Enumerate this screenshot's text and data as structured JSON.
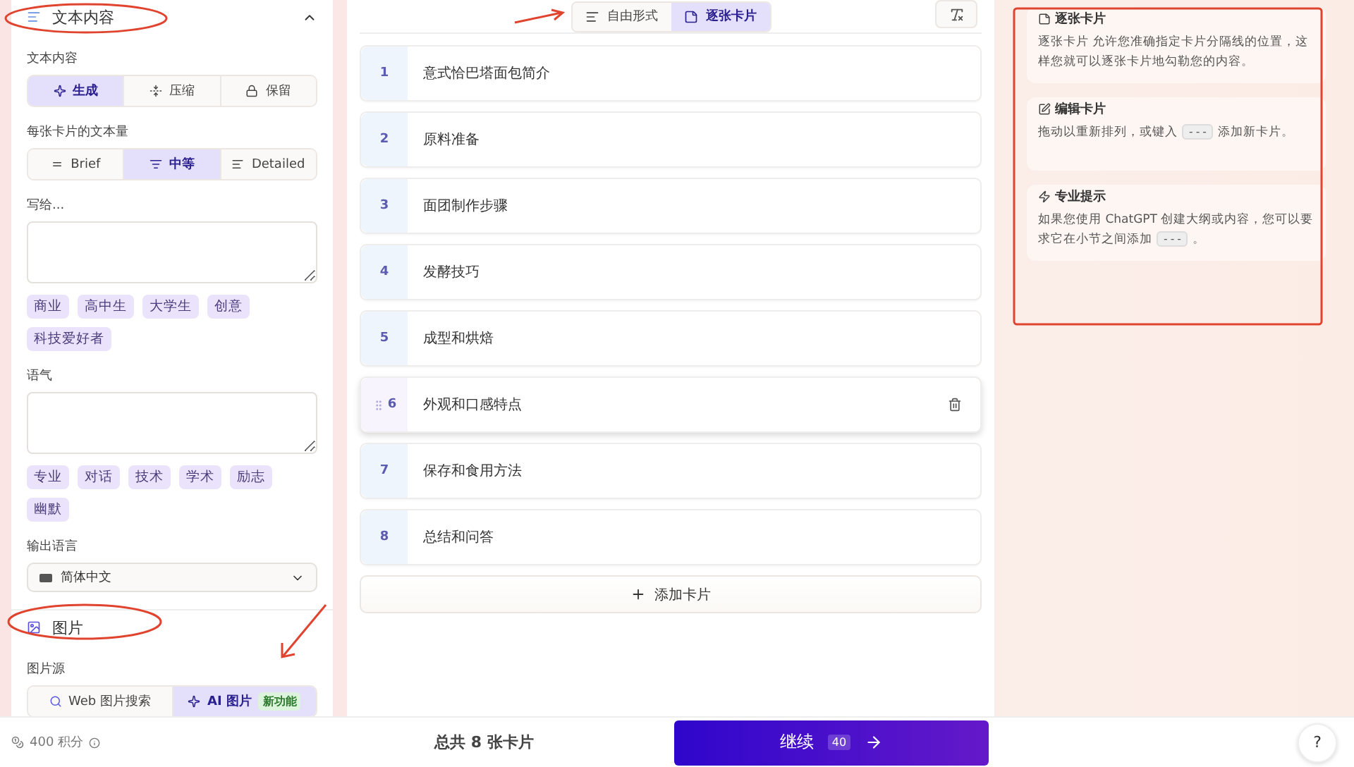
{
  "sidebar": {
    "text_section": {
      "title": "文本内容",
      "expanded": true,
      "content_label": "文本内容",
      "content_options": [
        {
          "kind": "generate",
          "label": "生成",
          "selected": true
        },
        {
          "kind": "condense",
          "label": "压缩",
          "selected": false
        },
        {
          "kind": "preserve",
          "label": "保留",
          "selected": false
        }
      ],
      "amount_label": "每张卡片的文本量",
      "amount_options": [
        {
          "kind": "brief",
          "label": "Brief",
          "selected": false
        },
        {
          "kind": "medium",
          "label": "中等",
          "selected": true
        },
        {
          "kind": "detailed",
          "label": "Detailed",
          "selected": false
        }
      ],
      "audience_label": "写给...",
      "audience_tags": [
        "商业",
        "高中生",
        "大学生",
        "创意",
        "科技爱好者"
      ],
      "tone_label": "语气",
      "tone_tags": [
        "专业",
        "对话",
        "技术",
        "学术",
        "励志",
        "幽默"
      ],
      "language_label": "输出语言",
      "language_value": "简体中文"
    },
    "image_section": {
      "title": "图片",
      "source_label": "图片源",
      "source_options": [
        {
          "kind": "web",
          "label": "Web 图片搜索",
          "selected": false
        },
        {
          "kind": "ai",
          "label": "AI 图片",
          "selected": true,
          "badge": "新功能"
        }
      ]
    }
  },
  "editor": {
    "modes": [
      {
        "kind": "freeform",
        "label": "自由形式",
        "selected": false
      },
      {
        "kind": "cards",
        "label": "逐张卡片",
        "selected": true
      }
    ],
    "cards": [
      {
        "number": "1",
        "title": "意式恰巴塔面包简介",
        "hovered": false
      },
      {
        "number": "2",
        "title": "原料准备",
        "hovered": false
      },
      {
        "number": "3",
        "title": "面团制作步骤",
        "hovered": false
      },
      {
        "number": "4",
        "title": "发酵技巧",
        "hovered": false
      },
      {
        "number": "5",
        "title": "成型和烘焙",
        "hovered": false
      },
      {
        "number": "6",
        "title": "外观和口感特点",
        "hovered": true
      },
      {
        "number": "7",
        "title": "保存和食用方法",
        "hovered": false
      },
      {
        "number": "8",
        "title": "总结和问答",
        "hovered": false
      }
    ],
    "add_card": "添加卡片"
  },
  "tips": [
    {
      "kind": "cards",
      "title": "逐张卡片",
      "text": "逐张卡片 允许您准确指定卡片分隔线的位置，这样您就可以逐张卡片地勾勒您的内容。"
    },
    {
      "kind": "edit",
      "title": "编辑卡片",
      "text": "拖动以重新排列，或键入",
      "code": "---",
      "text_after": "添加新卡片。"
    },
    {
      "kind": "pro",
      "title": "专业提示",
      "text": "如果您使用 ChatGPT 创建大纲或内容，您可以要求它在小节之间添加",
      "code": "---",
      "text_after": "。"
    }
  ],
  "footer": {
    "credits": "400 积分",
    "total": "总共 8 张卡片",
    "continue_label": "继续",
    "continue_cost": "40",
    "help": "?"
  }
}
